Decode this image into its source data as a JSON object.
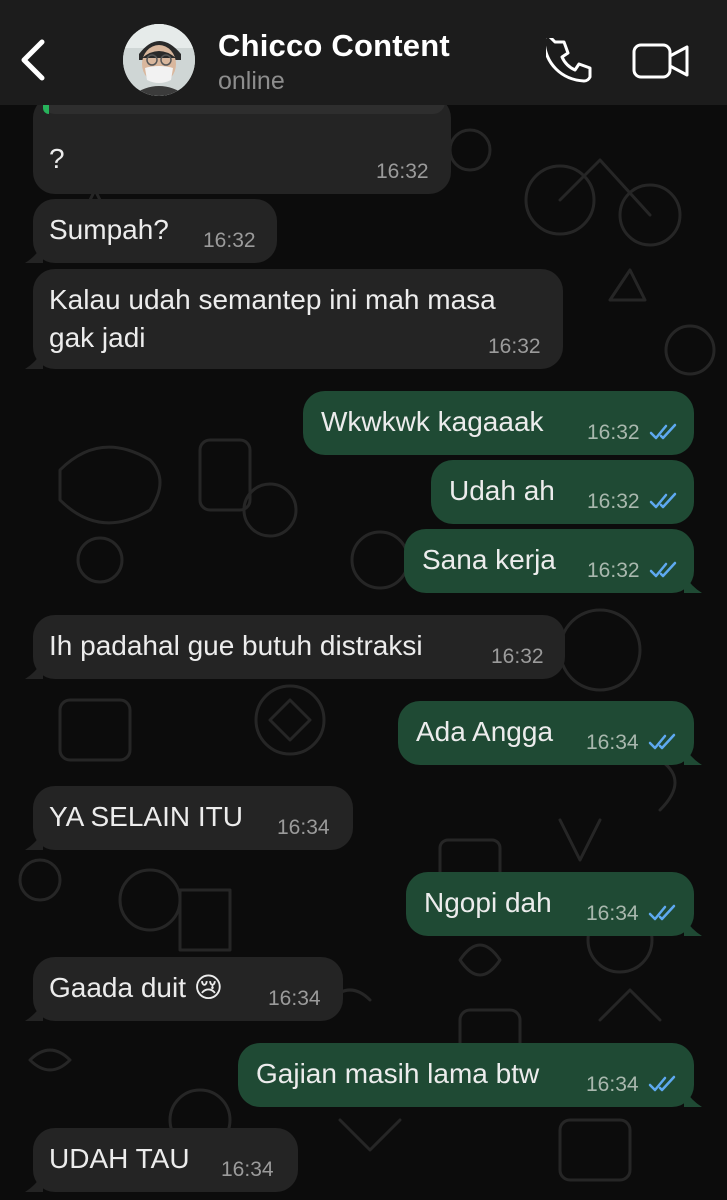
{
  "header": {
    "back_label": "",
    "contact_name": "Chicco Content",
    "status": "online"
  },
  "icons": {
    "back": "chevron-left-icon",
    "call": "phone-icon",
    "video": "video-camera-icon",
    "read_receipt": "double-check-icon"
  },
  "colors": {
    "incoming_bubble": "#242424",
    "outgoing_bubble": "#1f4a34",
    "read_ticks": "#5ea9f0",
    "header_bg": "#1c1c1c",
    "quote_accent": "#27b35b"
  },
  "messages": [
    {
      "direction": "in",
      "text": "?",
      "time": "16:32"
    },
    {
      "direction": "in",
      "text": "Sumpah?",
      "time": "16:32"
    },
    {
      "direction": "in",
      "text": "Kalau udah semantep ini mah masa\ngak jadi",
      "time": "16:32"
    },
    {
      "direction": "out",
      "text": "Wkwkwk kagaaak",
      "time": "16:32",
      "read": true
    },
    {
      "direction": "out",
      "text": "Udah ah",
      "time": "16:32",
      "read": true
    },
    {
      "direction": "out",
      "text": "Sana kerja",
      "time": "16:32",
      "read": true
    },
    {
      "direction": "in",
      "text": "Ih padahal gue butuh distraksi",
      "time": "16:32"
    },
    {
      "direction": "out",
      "text": "Ada Angga",
      "time": "16:34",
      "read": true
    },
    {
      "direction": "in",
      "text": "YA SELAIN ITU",
      "time": "16:34"
    },
    {
      "direction": "out",
      "text": "Ngopi dah",
      "time": "16:34",
      "read": true
    },
    {
      "direction": "in",
      "text": "Gaada duit 😢",
      "time": "16:34"
    },
    {
      "direction": "out",
      "text": "Gajian masih lama btw",
      "time": "16:34",
      "read": true
    },
    {
      "direction": "in",
      "text": "UDAH TAU",
      "time": "16:34"
    }
  ]
}
